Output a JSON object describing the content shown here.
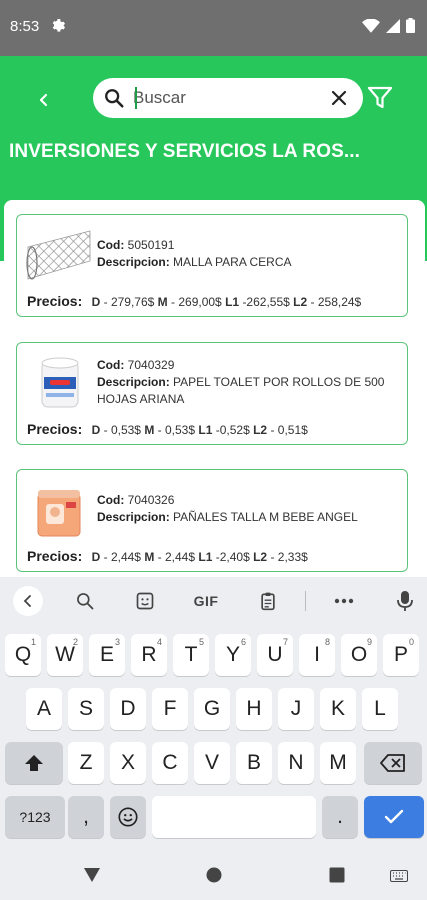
{
  "status_bar": {
    "time": "8:53"
  },
  "header": {
    "search_placeholder": "Buscar",
    "title": "INVERSIONES Y SERVICIOS LA ROS..."
  },
  "labels": {
    "cod": "Cod:",
    "descripcion": "Descripcion:",
    "precios": "Precios:"
  },
  "products": [
    {
      "cod": "5050191",
      "descripcion": "MALLA PARA CERCA",
      "prices": [
        {
          "key": "D",
          "value": "- 279,76$"
        },
        {
          "key": "M",
          "value": "- 269,00$"
        },
        {
          "key": "L1",
          "value": "-262,55$"
        },
        {
          "key": "L2",
          "value": "- 258,24$"
        }
      ]
    },
    {
      "cod": "7040329",
      "descripcion": "PAPEL TOALET POR ROLLOS DE 500 HOJAS ARIANA",
      "prices": [
        {
          "key": "D",
          "value": "- 0,53$"
        },
        {
          "key": "M",
          "value": "- 0,53$"
        },
        {
          "key": "L1",
          "value": "-0,52$"
        },
        {
          "key": "L2",
          "value": "- 0,51$"
        }
      ]
    },
    {
      "cod": "7040326",
      "descripcion": "PAÑALES TALLA M BEBE ANGEL",
      "prices": [
        {
          "key": "D",
          "value": "- 2,44$"
        },
        {
          "key": "M",
          "value": "- 2,44$"
        },
        {
          "key": "L1",
          "value": "-2,40$"
        },
        {
          "key": "L2",
          "value": "- 2,33$"
        }
      ]
    }
  ],
  "keyboard": {
    "toolbar": {
      "gif": "GIF"
    },
    "row1": [
      {
        "k": "Q",
        "h": "1"
      },
      {
        "k": "W",
        "h": "2"
      },
      {
        "k": "E",
        "h": "3"
      },
      {
        "k": "R",
        "h": "4"
      },
      {
        "k": "T",
        "h": "5"
      },
      {
        "k": "Y",
        "h": "6"
      },
      {
        "k": "U",
        "h": "7"
      },
      {
        "k": "I",
        "h": "8"
      },
      {
        "k": "O",
        "h": "9"
      },
      {
        "k": "P",
        "h": "0"
      }
    ],
    "row2": [
      "A",
      "S",
      "D",
      "F",
      "G",
      "H",
      "J",
      "K",
      "L"
    ],
    "row3": [
      "Z",
      "X",
      "C",
      "V",
      "B",
      "N",
      "M"
    ],
    "symbols": "?123",
    "comma": ",",
    "period": "."
  },
  "colors": {
    "brand_green": "#28c75c",
    "card_border": "#5cc47a",
    "enter_key": "#3b7de0"
  }
}
